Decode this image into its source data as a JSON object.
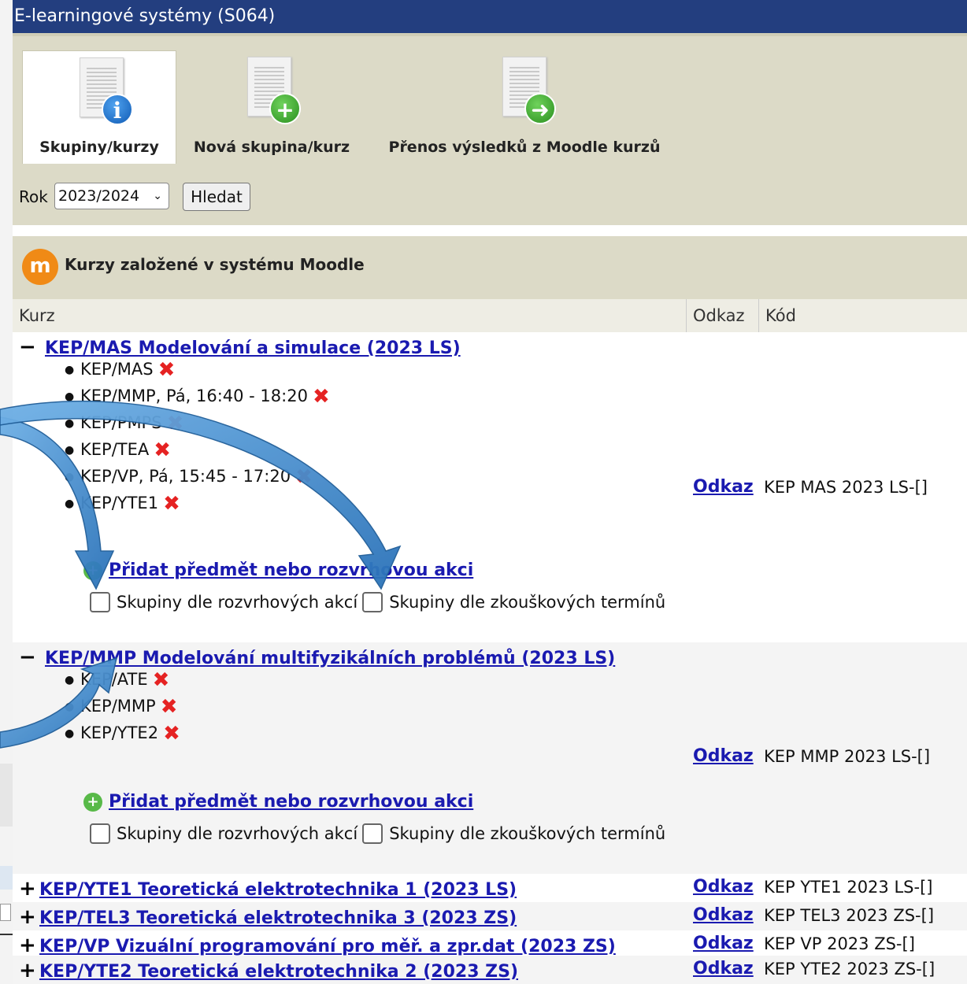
{
  "window": {
    "title": "E-learningové systémy (S064)"
  },
  "tabs": [
    {
      "label": "Skupiny/kurzy",
      "icon": "info-document-icon",
      "active": true
    },
    {
      "label": "Nová skupina/kurz",
      "icon": "add-document-icon",
      "active": false
    },
    {
      "label": "Přenos výsledků z Moodle kurzů",
      "icon": "transfer-document-icon",
      "active": false
    }
  ],
  "filter": {
    "year_label": "Rok",
    "year_value": "2023/2024",
    "search_label": "Hledat"
  },
  "section": {
    "title": "Kurzy založené v systému Moodle",
    "icon": "moodle-icon"
  },
  "table": {
    "headers": {
      "course": "Kurz",
      "link": "Odkaz",
      "code": "Kód"
    }
  },
  "courses": [
    {
      "sign": "−",
      "title": "KEP/MAS Modelování a simulace (2023 LS)",
      "expanded": true,
      "items": [
        "KEP/MAS",
        "KEP/MMP, Pá, 16:40 - 18:20",
        "KEP/PMPS",
        "KEP/TEA",
        "KEP/VP, Pá, 15:45 - 17:20",
        "KEP/YTE1"
      ],
      "add_label": "Přidat předmět nebo rozvrhovou akci",
      "chk1_label": "Skupiny dle rozvrhových akcí",
      "chk2_label": "Skupiny dle zkouškových termínů",
      "link_label": "Odkaz",
      "code": "KEP MAS 2023 LS-[]"
    },
    {
      "sign": "−",
      "title": "KEP/MMP Modelování multifyzikálních problémů (2023 LS)",
      "expanded": true,
      "items": [
        "KEP/ATE",
        "KEP/MMP",
        "KEP/YTE2"
      ],
      "add_label": "Přidat předmět nebo rozvrhovou akci",
      "chk1_label": "Skupiny dle rozvrhových akcí",
      "chk2_label": "Skupiny dle zkouškových termínů",
      "link_label": "Odkaz",
      "code": "KEP MMP 2023 LS-[]"
    },
    {
      "sign": "+",
      "title": "KEP/YTE1 Teoretická elektrotechnika 1 (2023 LS)",
      "link_label": "Odkaz",
      "code": "KEP YTE1 2023 LS-[]"
    },
    {
      "sign": "+",
      "title": "KEP/TEL3 Teoretická elektrotechnika 3 (2023 ZS)",
      "link_label": "Odkaz",
      "code": "KEP TEL3 2023 ZS-[]"
    },
    {
      "sign": "+",
      "title": "KEP/VP Vizuální programování pro měř. a zpr.dat (2023 ZS)",
      "link_label": "Odkaz",
      "code": "KEP VP 2023 ZS-[]"
    },
    {
      "sign": "+",
      "title": "KEP/YTE2 Teoretická elektrotechnika 2 (2023 ZS)",
      "link_label": "Odkaz",
      "code": "KEP YTE2 2023 ZS-[]"
    }
  ],
  "colors": {
    "title_bar": "#233e7f",
    "panel": "#dcdac7",
    "link": "#1a1ab0",
    "remove": "#e52222",
    "annotation_arrow": "#3a86c8"
  }
}
